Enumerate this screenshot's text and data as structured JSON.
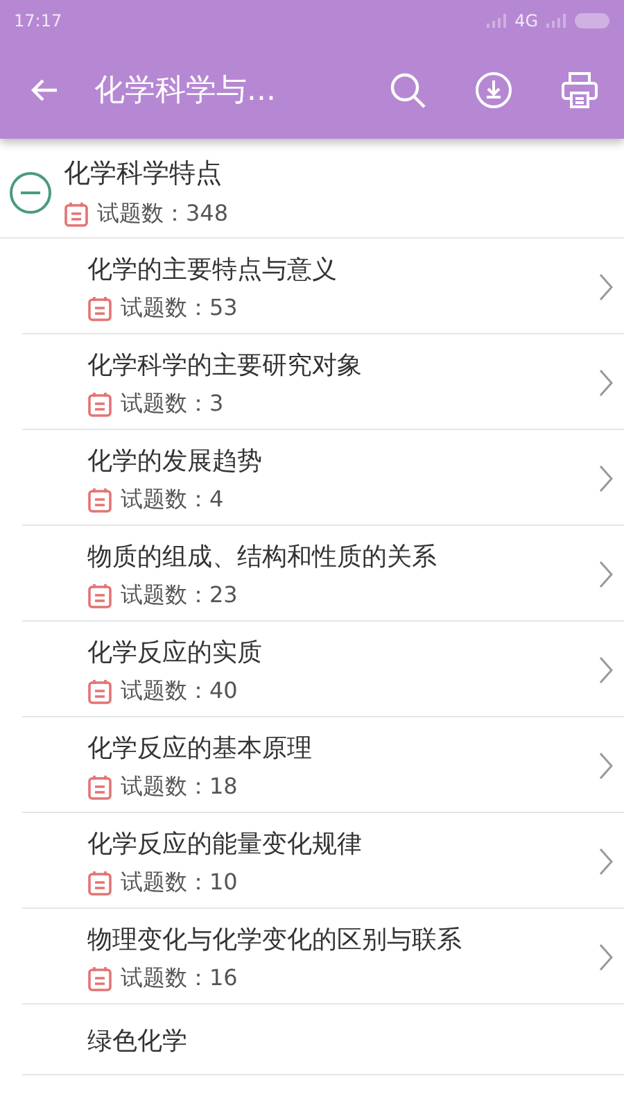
{
  "status_bar": {
    "time": "17:17",
    "network": "4G"
  },
  "toolbar": {
    "title": "化学科学与..."
  },
  "section": {
    "title": "化学科学特点",
    "count_label": "试题数：348",
    "expanded": true,
    "children": [
      {
        "title": "化学的主要特点与意义",
        "count_label": "试题数：53"
      },
      {
        "title": "化学科学的主要研究对象",
        "count_label": "试题数：3"
      },
      {
        "title": "化学的发展趋势",
        "count_label": "试题数：4"
      },
      {
        "title": "物质的组成、结构和性质的关系",
        "count_label": "试题数：23"
      },
      {
        "title": "化学反应的实质",
        "count_label": "试题数：40"
      },
      {
        "title": "化学反应的基本原理",
        "count_label": "试题数：18"
      },
      {
        "title": "化学反应的能量变化规律",
        "count_label": "试题数：10"
      },
      {
        "title": "物理变化与化学变化的区别与联系",
        "count_label": "试题数：16"
      },
      {
        "title": "绿色化学"
      }
    ]
  }
}
